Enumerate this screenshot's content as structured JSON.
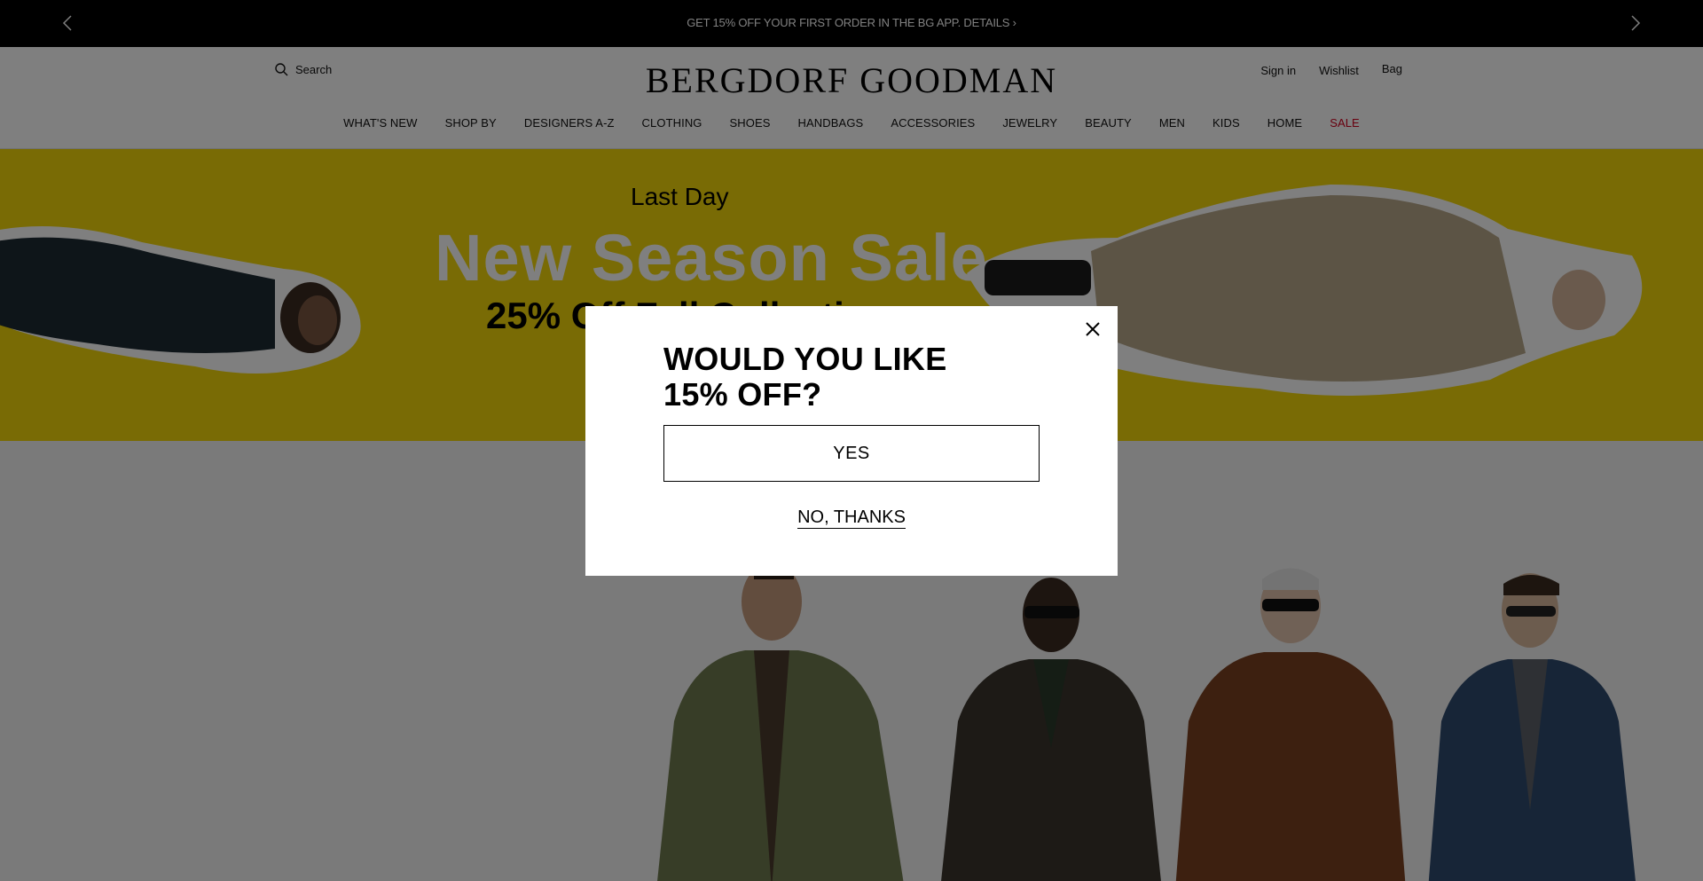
{
  "promo": {
    "text": "GET 15% OFF YOUR FIRST ORDER IN THE BG APP. DETAILS ›",
    "prev_icon": "chevron-left-icon",
    "next_icon": "chevron-right-icon"
  },
  "header": {
    "search_label": "Search",
    "logo": "BERGDORF GOODMAN",
    "sign_in": "Sign in",
    "wishlist": "Wishlist",
    "bag": "Bag"
  },
  "nav": {
    "items": [
      "WHAT'S NEW",
      "SHOP BY",
      "DESIGNERS A-Z",
      "CLOTHING",
      "SHOES",
      "HANDBAGS",
      "ACCESSORIES",
      "JEWELRY",
      "BEAUTY",
      "MEN",
      "KIDS",
      "HOME",
      "SALE"
    ],
    "sale_color": "#d1001f"
  },
  "hero": {
    "kicker": "Last Day",
    "headline": "New Season Sale",
    "subline": "25% Off Fall Collections",
    "background": "#f2d70a"
  },
  "modal": {
    "title_line1": "WOULD YOU LIKE",
    "title_line2": "15% OFF?",
    "yes_label": "YES",
    "no_label": "NO, THANKS",
    "close_icon": "close-icon"
  }
}
